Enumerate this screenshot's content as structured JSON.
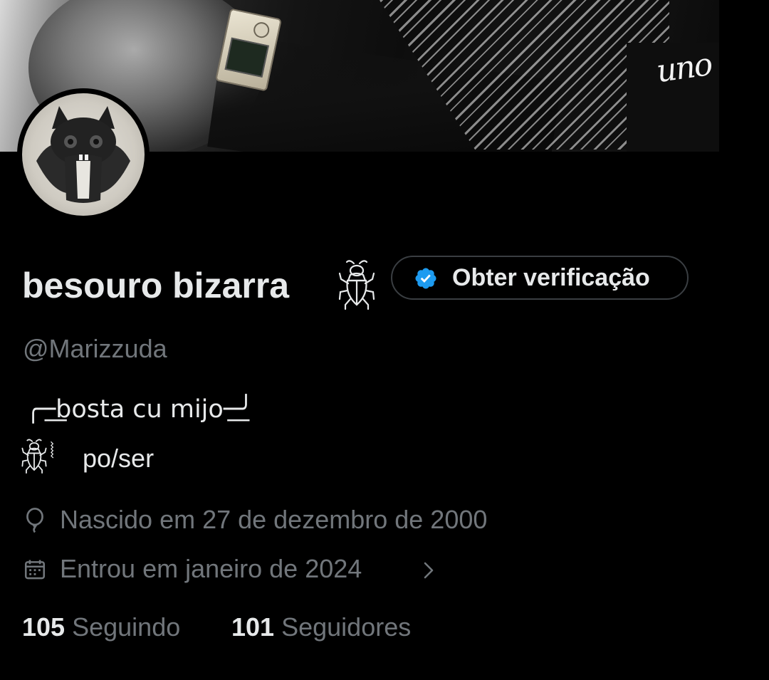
{
  "profile": {
    "display_name": "besouro bizarra",
    "name_emoji_icon": "beetle-icon",
    "verify_button_label": "Obter verificação",
    "handle": "@Marizzuda",
    "bio_line1": "╭─͟͟bosta cu mijo─͟͟╯",
    "bio_line2_icon": "beetle-icon",
    "bio_line2_brace": "⦚",
    "bio_line2_text": "po/ser",
    "birthday": "Nascido em 27 de dezembro de 2000",
    "joined": "Entrou em janeiro de 2024",
    "following_count": "105",
    "following_label": "Seguindo",
    "followers_count": "101",
    "followers_label": "Seguidores"
  },
  "banner": {
    "overlay_text": "uno"
  },
  "colors": {
    "background": "#000000",
    "primary_text": "#e7e9ea",
    "secondary_text": "#71767b",
    "verified_blue": "#1d9bf0",
    "button_border": "#3a3e42"
  },
  "icons": {
    "birthday": "balloon-icon",
    "joined": "calendar-icon",
    "more": "chevron-right-icon",
    "verified": "verified-badge-icon"
  }
}
